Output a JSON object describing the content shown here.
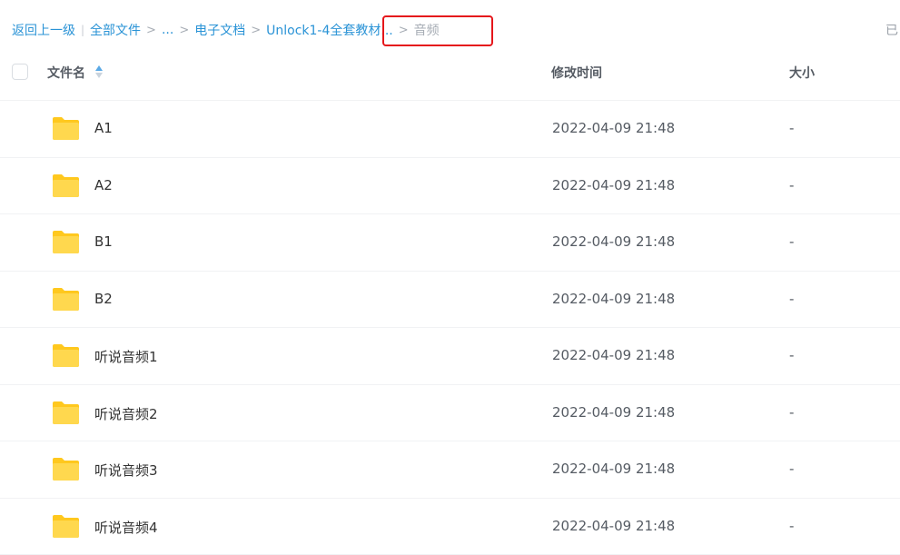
{
  "breadcrumb": {
    "back": "返回上一级",
    "pipe": "|",
    "all_files": "全部文件",
    "sep": ">",
    "ellipsis": "...",
    "docs": "电子文档",
    "unlock": "Unlock1-4全套教材...",
    "current": "音频"
  },
  "right_edge_text": "已",
  "header": {
    "name": "文件名",
    "time": "修改时间",
    "size": "大小"
  },
  "rows": [
    {
      "name": "A1",
      "time": "2022-04-09 21:48",
      "size": "-"
    },
    {
      "name": "A2",
      "time": "2022-04-09 21:48",
      "size": "-"
    },
    {
      "name": "B1",
      "time": "2022-04-09 21:48",
      "size": "-"
    },
    {
      "name": "B2",
      "time": "2022-04-09 21:48",
      "size": "-"
    },
    {
      "name": "听说音频1",
      "time": "2022-04-09 21:48",
      "size": "-"
    },
    {
      "name": "听说音频2",
      "time": "2022-04-09 21:48",
      "size": "-"
    },
    {
      "name": "听说音频3",
      "time": "2022-04-09 21:48",
      "size": "-"
    },
    {
      "name": "听说音频4",
      "time": "2022-04-09 21:48",
      "size": "-"
    }
  ],
  "colors": {
    "link": "#2a93d6",
    "folder": "#ffd54a",
    "highlight_box": "#e5161b"
  }
}
